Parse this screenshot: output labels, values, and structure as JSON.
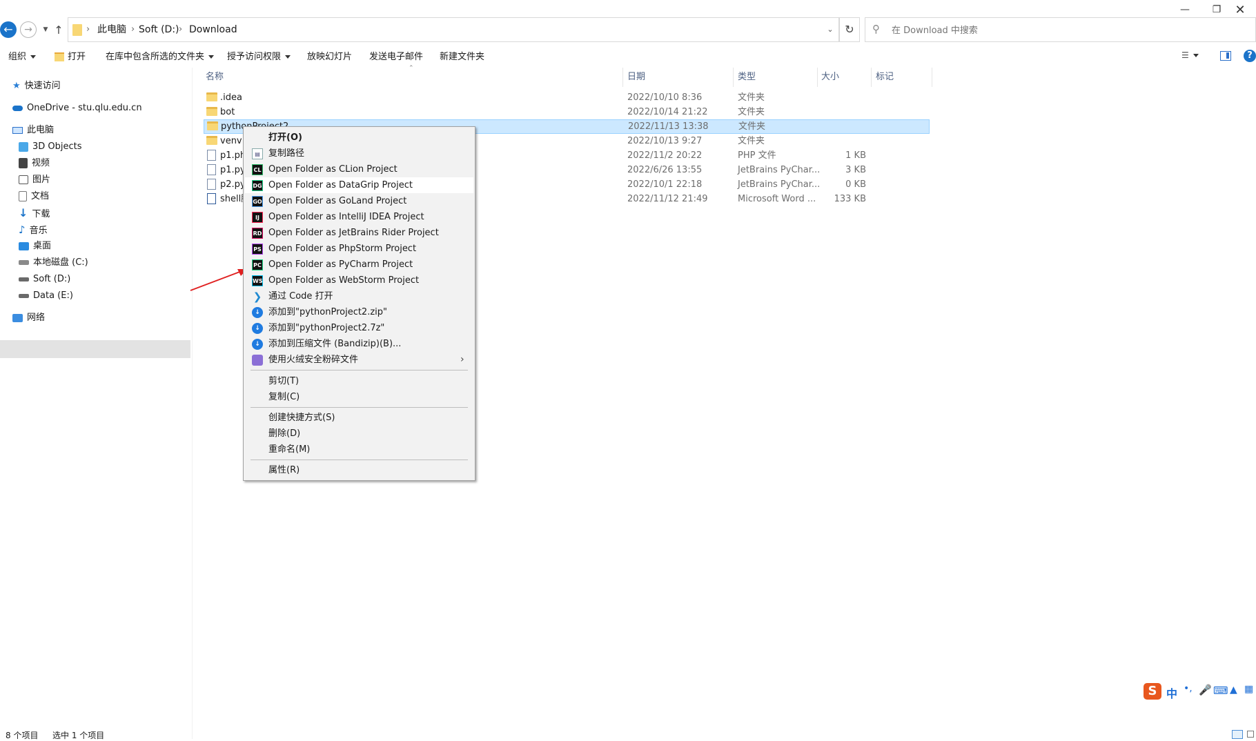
{
  "window": {
    "minimize_icon": "minimize-icon",
    "restore_icon": "restore-icon",
    "close_icon": "close-icon"
  },
  "nav": {
    "back_icon": "back-arrow-icon",
    "forward_icon": "forward-arrow-icon",
    "recent_icon": "chevron-down-icon",
    "up_icon": "up-arrow-icon",
    "breadcrumb": [
      "此电脑",
      "Soft (D:)",
      "Download"
    ],
    "refresh_icon": "refresh-icon",
    "search_placeholder": "在 Download 中搜索"
  },
  "toolbar": {
    "organize": "组织",
    "open": "打开",
    "include_in_library": "在库中包含所选的文件夹",
    "grant_access": "授予访问权限",
    "slideshow": "放映幻灯片",
    "email": "发送电子邮件",
    "new_folder": "新建文件夹"
  },
  "sidebar": {
    "quick_access": "快速访问",
    "onedrive": "OneDrive - stu.qlu.edu.cn",
    "this_pc": "此电脑",
    "items": [
      "3D Objects",
      "视频",
      "图片",
      "文档",
      "下载",
      "音乐",
      "桌面",
      "本地磁盘 (C:)",
      "Soft (D:)",
      "Data (E:)"
    ],
    "network": "网络"
  },
  "columns": {
    "name": "名称",
    "date": "日期",
    "type": "类型",
    "size": "大小",
    "tags": "标记"
  },
  "files": [
    {
      "name": ".idea",
      "date": "2022/10/10 8:36",
      "type": "文件夹",
      "size": "",
      "kind": "folder"
    },
    {
      "name": "bot",
      "date": "2022/10/14 21:22",
      "type": "文件夹",
      "size": "",
      "kind": "folder"
    },
    {
      "name": "pythonProject2",
      "date": "2022/11/13 13:38",
      "type": "文件夹",
      "size": "",
      "kind": "folder"
    },
    {
      "name": "venv",
      "date": "2022/10/13 9:27",
      "type": "文件夹",
      "size": "",
      "kind": "folder"
    },
    {
      "name": "p1.ph",
      "date": "2022/11/2 20:22",
      "type": "PHP 文件",
      "size": "1 KB",
      "kind": "php"
    },
    {
      "name": "p1.py",
      "date": "2022/6/26 13:55",
      "type": "JetBrains PyChar...",
      "size": "3 KB",
      "kind": "py"
    },
    {
      "name": "p2.py",
      "date": "2022/10/1 22:18",
      "type": "JetBrains PyChar...",
      "size": "0 KB",
      "kind": "py"
    },
    {
      "name": "shell脚",
      "date": "2022/11/12 21:49",
      "type": "Microsoft Word ...",
      "size": "133 KB",
      "kind": "word"
    }
  ],
  "context_menu": {
    "items": [
      {
        "label": "打开(O)",
        "icon": "",
        "bold": true
      },
      {
        "label": "复制路径",
        "icon": "copy-path-icon"
      },
      {
        "label": "Open Folder as CLion Project",
        "icon": "clion-icon",
        "abbr": "CL"
      },
      {
        "label": "Open Folder as DataGrip Project",
        "icon": "datagrip-icon",
        "abbr": "DG"
      },
      {
        "label": "Open Folder as GoLand Project",
        "icon": "goland-icon",
        "abbr": "GO"
      },
      {
        "label": "Open Folder as IntelliJ IDEA Project",
        "icon": "intellij-icon",
        "abbr": "IJ"
      },
      {
        "label": "Open Folder as JetBrains Rider Project",
        "icon": "rider-icon",
        "abbr": "RD"
      },
      {
        "label": "Open Folder as PhpStorm Project",
        "icon": "phpstorm-icon",
        "abbr": "PS"
      },
      {
        "label": "Open Folder as PyCharm Project",
        "icon": "pycharm-icon",
        "abbr": "PC"
      },
      {
        "label": "Open Folder as WebStorm Project",
        "icon": "webstorm-icon",
        "abbr": "WS"
      },
      {
        "label": "通过 Code 打开",
        "icon": "vscode-icon"
      },
      {
        "label": "添加到\"pythonProject2.zip\"",
        "icon": "bandizip-icon"
      },
      {
        "label": "添加到\"pythonProject2.7z\"",
        "icon": "bandizip-icon"
      },
      {
        "label": "添加到压缩文件 (Bandizip)(B)...",
        "icon": "bandizip-icon"
      },
      {
        "label": "使用火绒安全粉碎文件",
        "icon": "huorong-icon"
      },
      {
        "label": "剪切(T)",
        "icon": ""
      },
      {
        "label": "复制(C)",
        "icon": ""
      },
      {
        "label": "创建快捷方式(S)",
        "icon": ""
      },
      {
        "label": "删除(D)",
        "icon": ""
      },
      {
        "label": "重命名(M)",
        "icon": ""
      },
      {
        "label": "属性(R)",
        "icon": ""
      }
    ]
  },
  "status": {
    "count": "8 个项目",
    "selected": "选中 1 个项目"
  },
  "ime": {
    "lang": "中",
    "logo_letter": "S"
  },
  "colors": {
    "selection": "#cce8ff",
    "selection_border": "#99d1ff",
    "accent": "#0078d7",
    "arrow": "#e02020",
    "folder": "#f8d775"
  }
}
